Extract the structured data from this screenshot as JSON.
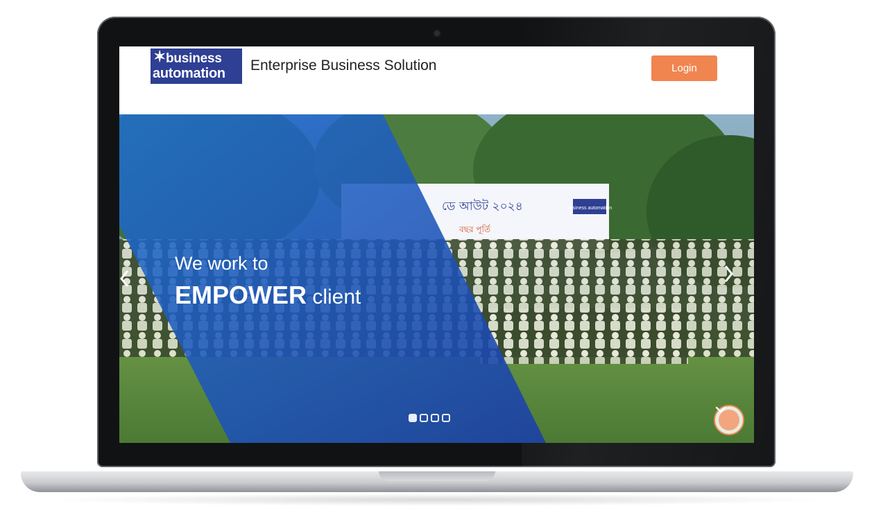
{
  "header": {
    "logo_line1": "business",
    "logo_line2": "automation",
    "title": "Enterprise Business Solution",
    "login_label": "Login"
  },
  "hero": {
    "line1": "We work to",
    "line2_strong": "EMPOWER",
    "line2_rest": " client",
    "banner_text": "ডে আউট ২০২৪",
    "banner_logo": "business automation",
    "banner_sub": "বছর পূর্তি",
    "slides_total": 4,
    "active_slide": 1
  },
  "icons": {
    "logo": "star-icon",
    "scroll": "chevron-down-icon",
    "prev": "chevron-left-icon",
    "next": "chevron-right-icon"
  },
  "colors": {
    "brand_blue": "#2e3f94",
    "accent_orange": "#f08550",
    "overlay_blue": "#1f5fc0"
  }
}
